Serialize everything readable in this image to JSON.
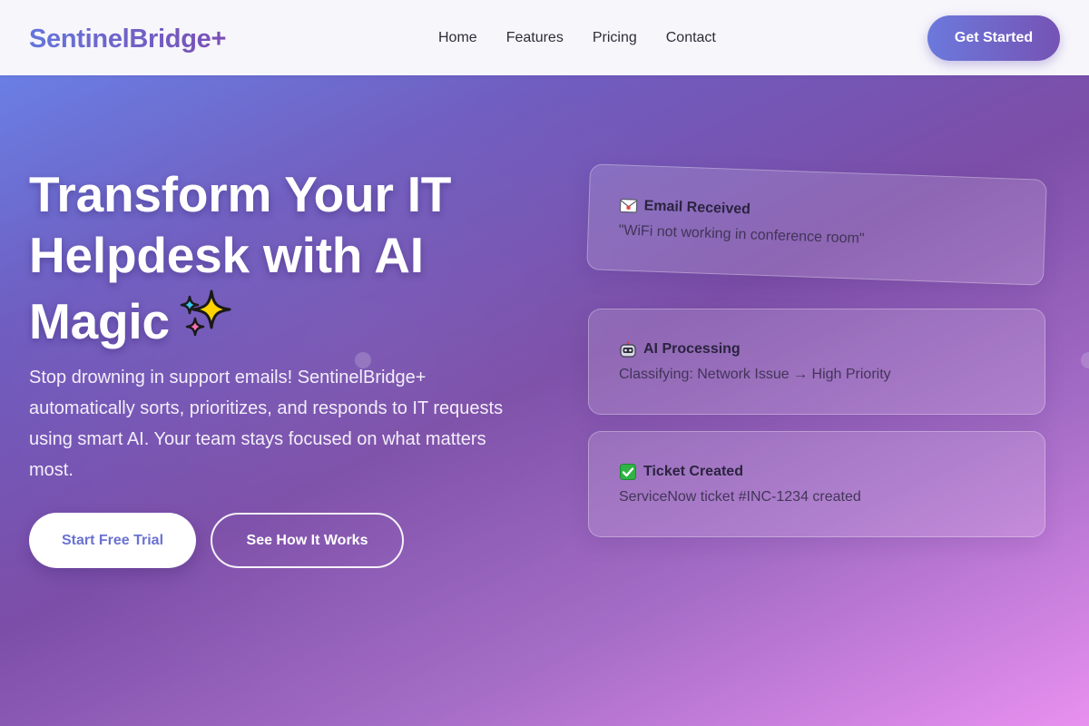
{
  "header": {
    "logo": "SentinelBridge+",
    "nav": [
      "Home",
      "Features",
      "Pricing",
      "Contact"
    ],
    "cta": "Get Started"
  },
  "hero": {
    "headline": "Transform Your IT Helpdesk with AI Magic",
    "headline_icon": "sparkles-icon",
    "subtext": "Stop drowning in support emails! SentinelBridge+ automatically sorts, prioritizes, and responds to IT requests using smart AI. Your team stays focused on what matters most.",
    "primary_button": "Start Free Trial",
    "secondary_button": "See How It Works"
  },
  "cards": [
    {
      "icon": "envelope-icon",
      "title": "Email Received",
      "body": "\"WiFi not working in conference room\""
    },
    {
      "icon": "robot-icon",
      "title": "AI Processing",
      "body": "Classifying: Network Issue → High Priority"
    },
    {
      "icon": "check-box-icon",
      "title": "Ticket Created",
      "body": "ServiceNow ticket #INC-1234 created"
    }
  ],
  "colors": {
    "accent": "#6c79dc",
    "accent_dark": "#7553b4",
    "hero_start": "#6a7fe4",
    "hero_end": "#e890f0",
    "check_green": "#2fb344"
  }
}
